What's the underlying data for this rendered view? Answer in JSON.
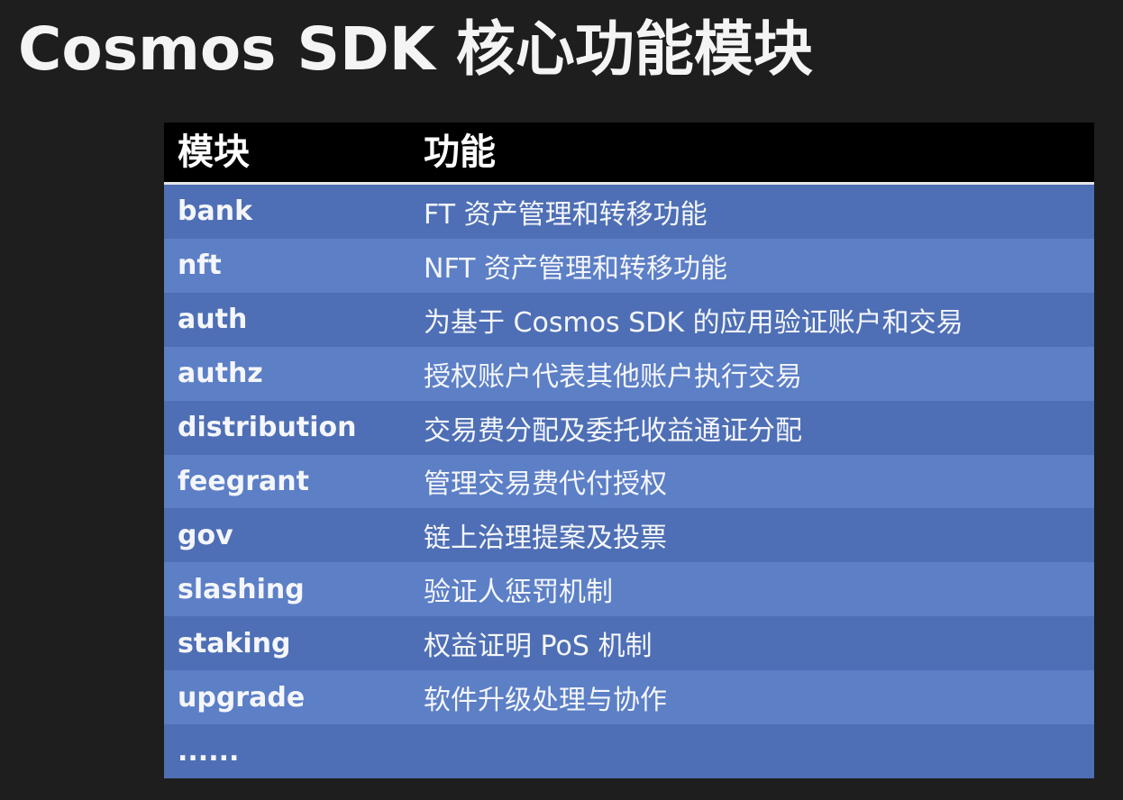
{
  "title": "Cosmos SDK 核心功能模块",
  "table": {
    "headers": {
      "module": "模块",
      "function": "功能"
    },
    "rows": [
      {
        "module": "bank",
        "function": "FT 资产管理和转移功能"
      },
      {
        "module": "nft",
        "function": "NFT 资产管理和转移功能"
      },
      {
        "module": "auth",
        "function": "为基于 Cosmos SDK 的应用验证账户和交易"
      },
      {
        "module": "authz",
        "function": "授权账户代表其他账户执行交易"
      },
      {
        "module": "distribution",
        "function": "交易费分配及委托收益通证分配"
      },
      {
        "module": "feegrant",
        "function": "管理交易费代付授权"
      },
      {
        "module": "gov",
        "function": "链上治理提案及投票"
      },
      {
        "module": "slashing",
        "function": "验证人惩罚机制"
      },
      {
        "module": "staking",
        "function": "权益证明 PoS 机制"
      },
      {
        "module": "upgrade",
        "function": "软件升级处理与协作"
      },
      {
        "module": "......",
        "function": ""
      }
    ]
  },
  "colors": {
    "background": "#1e1e1e",
    "header_bg": "#000000",
    "row_odd": "#4e6fb5",
    "row_even": "#5c7fc6",
    "text": "#f4f6fb"
  }
}
